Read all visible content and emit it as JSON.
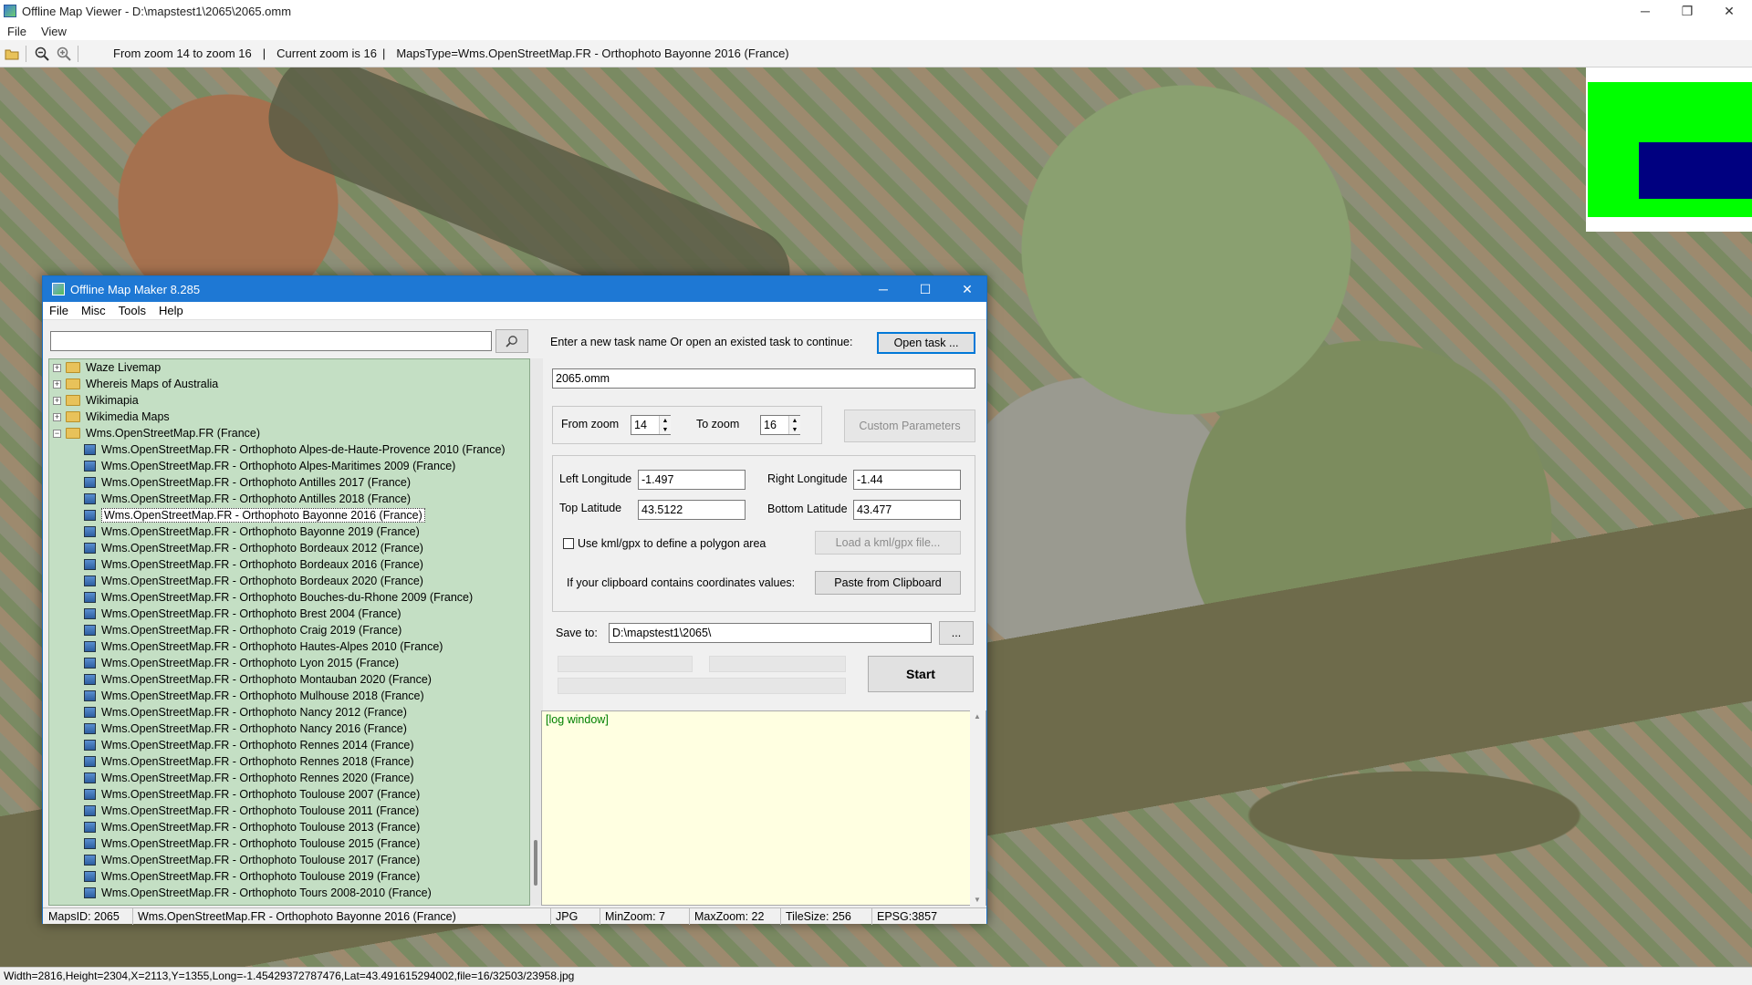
{
  "window": {
    "title": "Offline Map Viewer - D:\\mapstest1\\2065\\2065.omm",
    "controls": {
      "minimize": "─",
      "maximize": "❐",
      "close": "✕"
    }
  },
  "menubar": {
    "items": [
      "File",
      "View"
    ]
  },
  "toolbar": {
    "zoom_range": "From zoom 14 to zoom 16",
    "current_zoom": "Current zoom is 16",
    "maps_type": "MapsType=Wms.OpenStreetMap.FR - Orthophoto Bayonne 2016 (France)",
    "sep": "|"
  },
  "statusbar": {
    "text": "Width=2816,Height=2304,X=2113,Y=1355,Long=-1.45429372787476,Lat=43.491615294002,file=16/32503/23958.jpg"
  },
  "dialog": {
    "title": "Offline Map Maker 8.285",
    "controls": {
      "minimize": "─",
      "maximize": "☐",
      "close": "✕"
    },
    "menu": [
      "File",
      "Misc",
      "Tools",
      "Help"
    ],
    "search": {
      "value": "",
      "placeholder": ""
    },
    "tree": {
      "folders": [
        {
          "label": "Waze Livemap",
          "expanded": false
        },
        {
          "label": "Whereis Maps of Australia",
          "expanded": false
        },
        {
          "label": "Wikimapia",
          "expanded": false
        },
        {
          "label": "Wikimedia Maps",
          "expanded": false
        },
        {
          "label": "Wms.OpenStreetMap.FR (France)",
          "expanded": true
        }
      ],
      "children": [
        "Wms.OpenStreetMap.FR - Orthophoto Alpes-de-Haute-Provence 2010 (France)",
        "Wms.OpenStreetMap.FR - Orthophoto Alpes-Maritimes 2009 (France)",
        "Wms.OpenStreetMap.FR - Orthophoto Antilles 2017 (France)",
        "Wms.OpenStreetMap.FR - Orthophoto Antilles 2018 (France)",
        "Wms.OpenStreetMap.FR - Orthophoto Bayonne 2016 (France)",
        "Wms.OpenStreetMap.FR - Orthophoto Bayonne 2019 (France)",
        "Wms.OpenStreetMap.FR - Orthophoto Bordeaux 2012 (France)",
        "Wms.OpenStreetMap.FR - Orthophoto Bordeaux 2016 (France)",
        "Wms.OpenStreetMap.FR - Orthophoto Bordeaux 2020 (France)",
        "Wms.OpenStreetMap.FR - Orthophoto Bouches-du-Rhone 2009 (France)",
        "Wms.OpenStreetMap.FR - Orthophoto Brest 2004 (France)",
        "Wms.OpenStreetMap.FR - Orthophoto Craig 2019 (France)",
        "Wms.OpenStreetMap.FR - Orthophoto Hautes-Alpes 2010 (France)",
        "Wms.OpenStreetMap.FR - Orthophoto Lyon 2015 (France)",
        "Wms.OpenStreetMap.FR - Orthophoto Montauban 2020 (France)",
        "Wms.OpenStreetMap.FR - Orthophoto Mulhouse 2018 (France)",
        "Wms.OpenStreetMap.FR - Orthophoto Nancy 2012 (France)",
        "Wms.OpenStreetMap.FR - Orthophoto Nancy 2016 (France)",
        "Wms.OpenStreetMap.FR - Orthophoto Rennes 2014 (France)",
        "Wms.OpenStreetMap.FR - Orthophoto Rennes 2018 (France)",
        "Wms.OpenStreetMap.FR - Orthophoto Rennes 2020 (France)",
        "Wms.OpenStreetMap.FR - Orthophoto Toulouse 2007 (France)",
        "Wms.OpenStreetMap.FR - Orthophoto Toulouse 2011 (France)",
        "Wms.OpenStreetMap.FR - Orthophoto Toulouse 2013 (France)",
        "Wms.OpenStreetMap.FR - Orthophoto Toulouse 2015 (France)",
        "Wms.OpenStreetMap.FR - Orthophoto Toulouse 2017 (France)",
        "Wms.OpenStreetMap.FR - Orthophoto Toulouse 2019 (France)",
        "Wms.OpenStreetMap.FR - Orthophoto Tours 2008-2010 (France)"
      ],
      "selected": "Wms.OpenStreetMap.FR - Orthophoto Bayonne 2016 (France)"
    },
    "task": {
      "prompt": "Enter a new task name Or open an existed task to continue:",
      "open_label": "Open task ...",
      "name": "2065.omm"
    },
    "zoom": {
      "from_label": "From zoom",
      "from_value": "14",
      "to_label": "To zoom",
      "to_value": "16",
      "custom_label": "Custom Parameters"
    },
    "coords": {
      "left_lon_label": "Left Longitude",
      "left_lon": "-1.497",
      "right_lon_label": "Right Longitude",
      "right_lon": "-1.44",
      "top_lat_label": "Top Latitude",
      "top_lat": "43.5122",
      "bottom_lat_label": "Bottom Latitude",
      "bottom_lat": "43.477"
    },
    "kml": {
      "label": "Use kml/gpx to define a polygon area",
      "checked": false,
      "load_label": "Load a kml/gpx file..."
    },
    "clipboard": {
      "label": "If your clipboard contains coordinates values:",
      "paste_label": "Paste from Clipboard"
    },
    "save": {
      "label": "Save to:",
      "path": "D:\\mapstest1\\2065\\",
      "browse_label": "..."
    },
    "start_label": "Start",
    "log": {
      "text": "[log window]"
    },
    "status": {
      "maps_id": "MapsID: 2065",
      "maps_name": "Wms.OpenStreetMap.FR - Orthophoto Bayonne 2016 (France)",
      "format": "JPG",
      "min_zoom": "MinZoom: 7",
      "max_zoom": "MaxZoom: 22",
      "tile_size": "TileSize: 256",
      "epsg": "EPSG:3857"
    }
  },
  "colors": {
    "dialog_title": "#1e78d4",
    "tree_bg": "#c4dfc4",
    "log_bg": "#ffffe1",
    "minimap_green": "#00ff00",
    "minimap_blue": "#000080"
  }
}
